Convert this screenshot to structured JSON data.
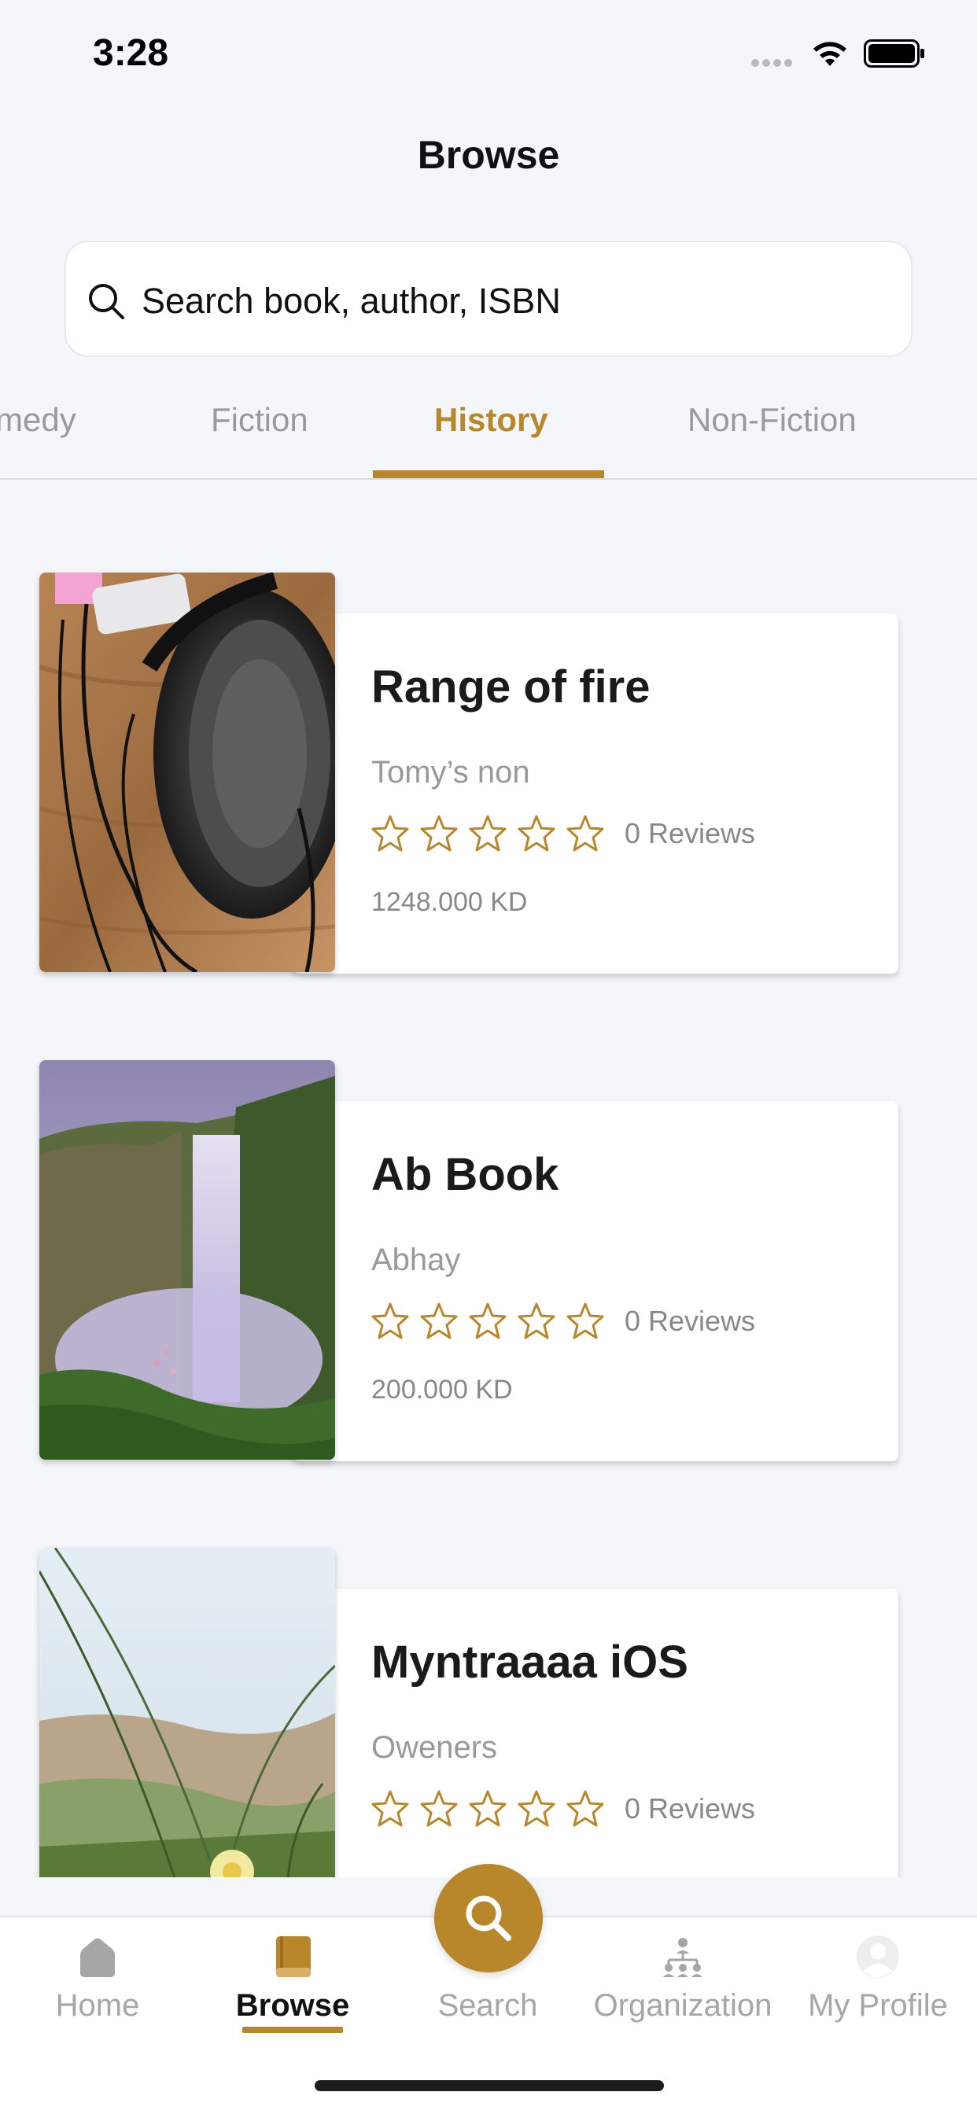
{
  "status_bar": {
    "time": "3:28"
  },
  "header": {
    "title": "Browse"
  },
  "search": {
    "placeholder": "Search book, author, ISBN"
  },
  "tabs": [
    {
      "label": "medy",
      "active": false
    },
    {
      "label": "Fiction",
      "active": false
    },
    {
      "label": "History",
      "active": true
    },
    {
      "label": "Non-Fiction",
      "active": false
    }
  ],
  "books": [
    {
      "title": "Range of fire",
      "author": "Tomy’s non",
      "rating": 0,
      "reviews": "0 Reviews",
      "price": "1248.000 KD",
      "cover": "headphones-photo"
    },
    {
      "title": "Ab Book",
      "author": "Abhay",
      "rating": 0,
      "reviews": "0 Reviews",
      "price": "200.000 KD",
      "cover": "waterfall-photo"
    },
    {
      "title": "Myntraaaa iOS",
      "author": "Oweners",
      "rating": 0,
      "reviews": "0 Reviews",
      "price": "",
      "cover": "flower-photo"
    }
  ],
  "tabbar": {
    "items": [
      {
        "label": "Home",
        "icon": "home-icon",
        "active": false
      },
      {
        "label": "Browse",
        "icon": "book-icon",
        "active": true
      },
      {
        "label": "Search",
        "icon": "search-icon",
        "active": false
      },
      {
        "label": "Organization",
        "icon": "organization-icon",
        "active": false
      },
      {
        "label": "My Profile",
        "icon": "profile-icon",
        "active": false
      }
    ]
  },
  "colors": {
    "accent": "#b8862b",
    "background": "#f4f6fa",
    "muted": "#9a9a9a"
  }
}
